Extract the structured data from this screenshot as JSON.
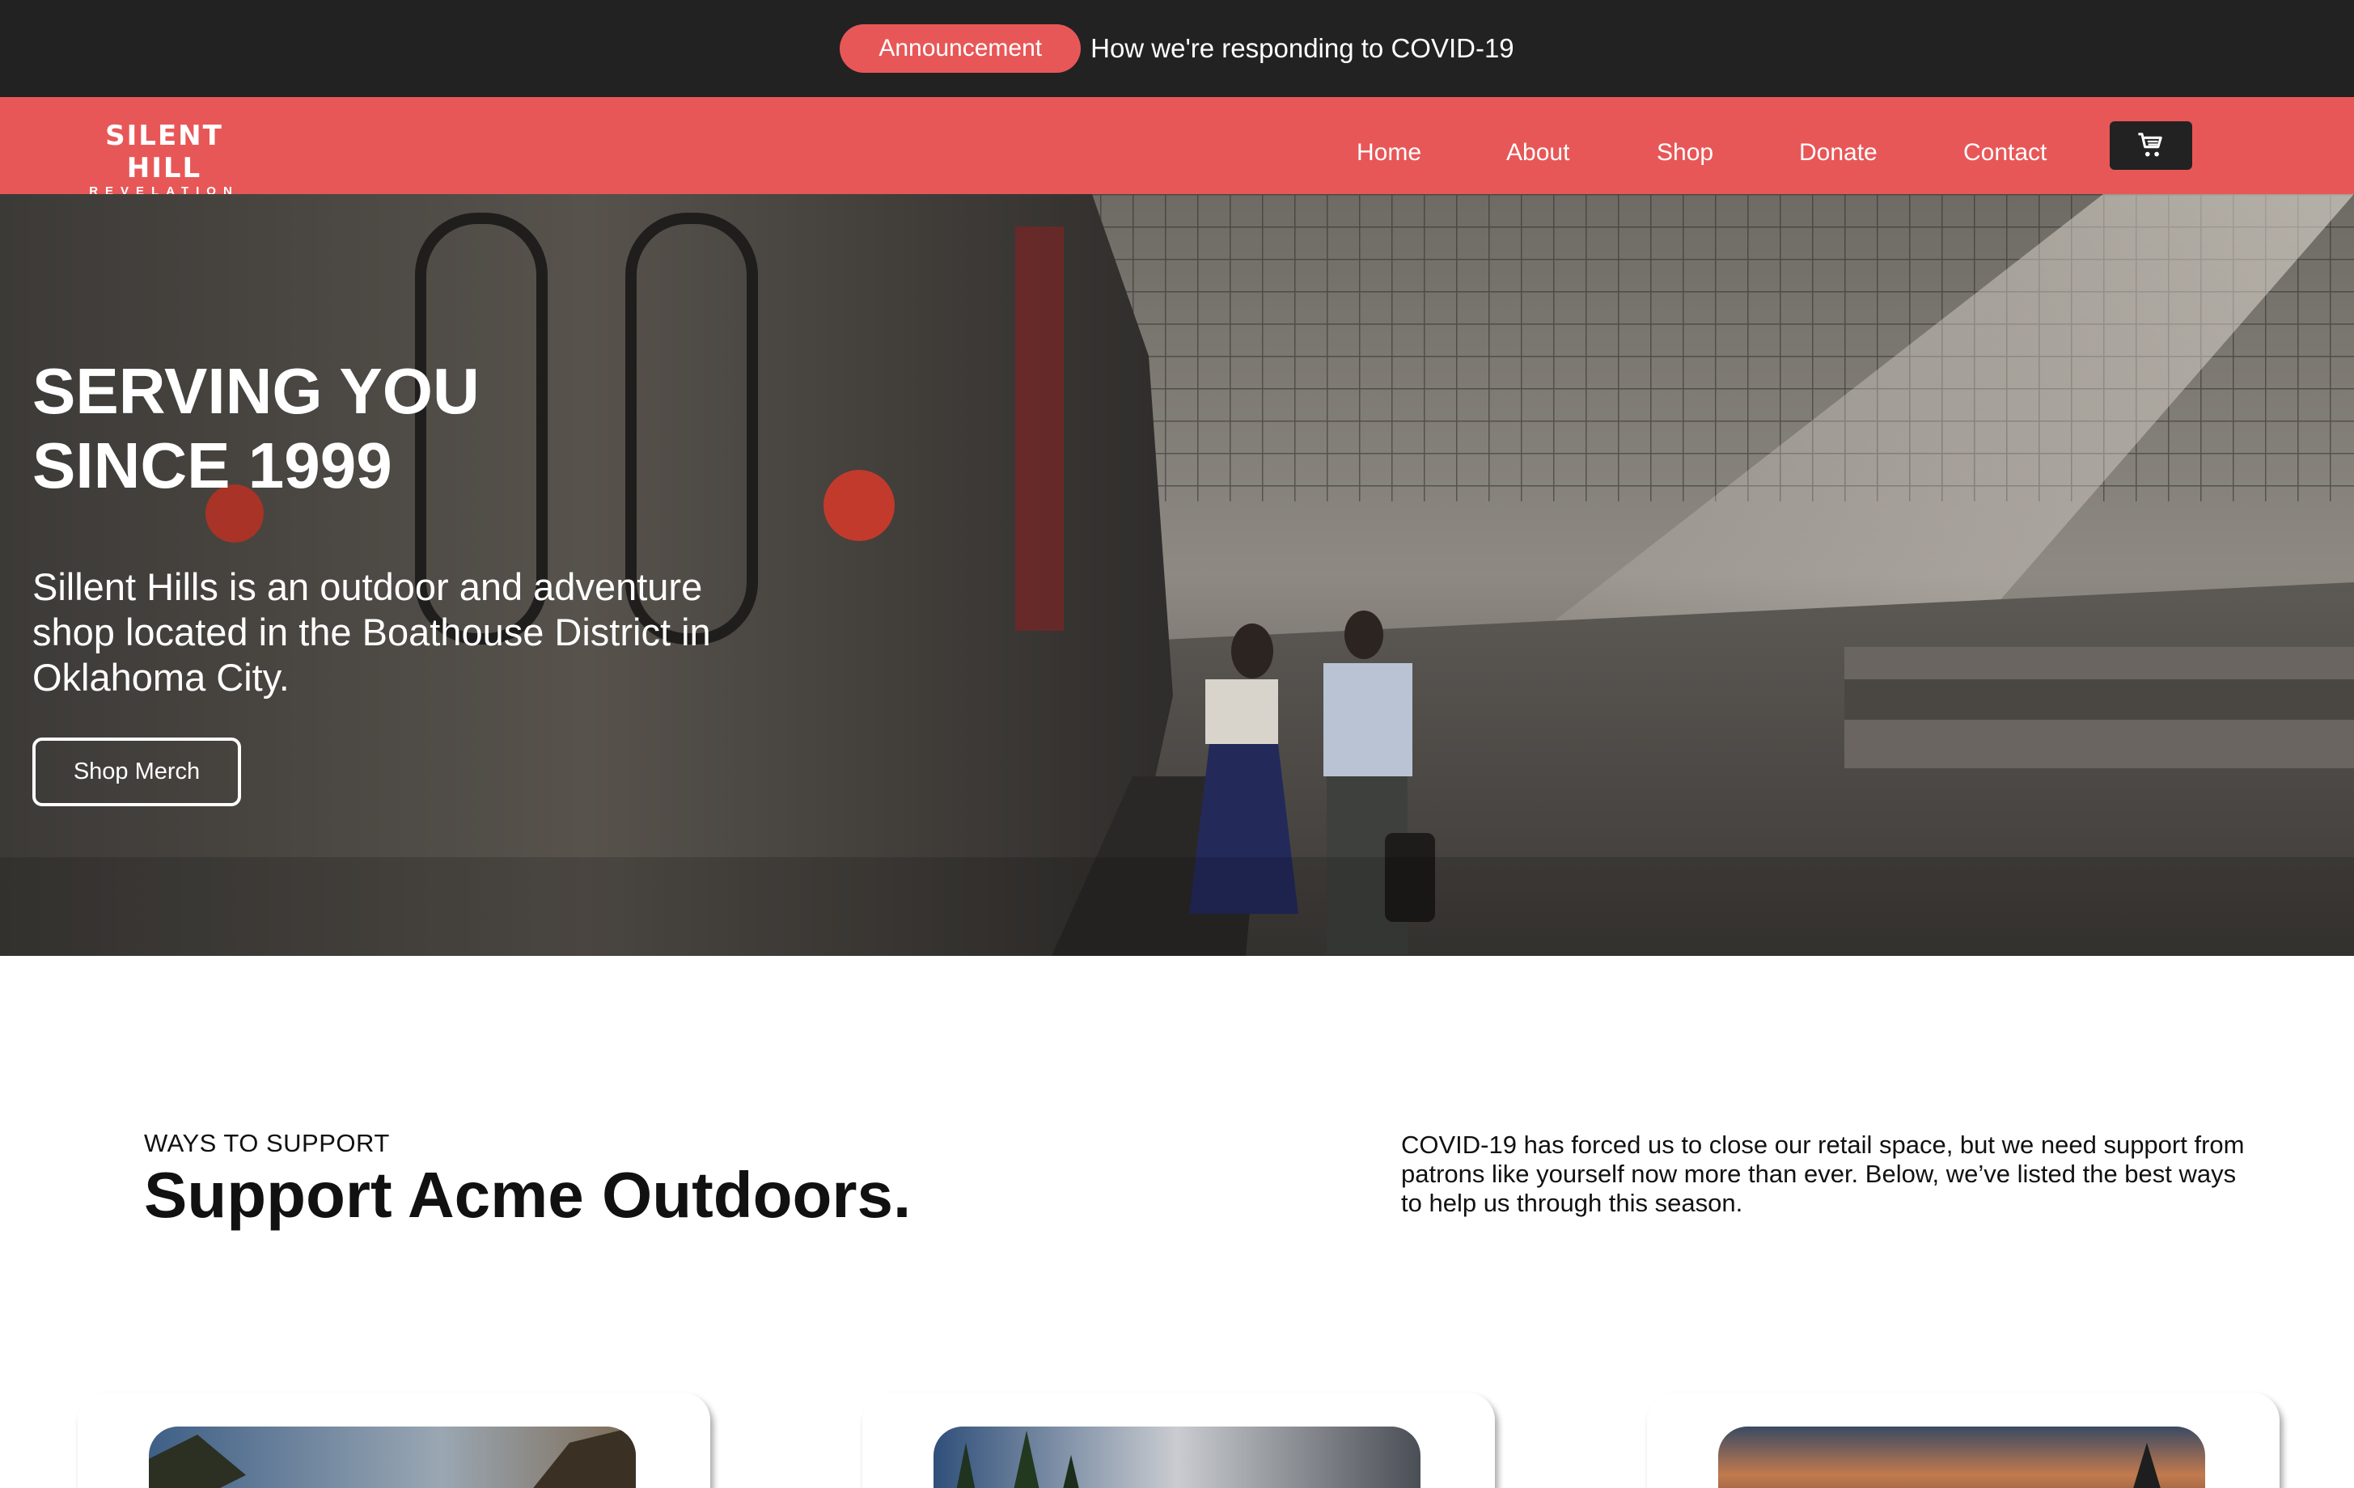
{
  "announcement": {
    "badge": "Announcement",
    "link": "How we're responding to COVID-19"
  },
  "nav": {
    "logo": {
      "main": "SILENT HILL",
      "sub": "REVELATION"
    },
    "items": [
      "Home",
      "About",
      "Shop",
      "Donate",
      "Contact"
    ],
    "cart_icon": "shopping-cart-icon"
  },
  "hero": {
    "title_line1": "SERVING YOU",
    "title_line2": "SINCE 1999",
    "description": "Sillent Hills is an outdoor and adventure shop located in the Boathouse District in Oklahoma City.",
    "cta": "Shop Merch"
  },
  "support": {
    "eyebrow": "WAYS TO SUPPORT",
    "title": "Support Acme Outdoors.",
    "description": "COVID-19 has forced us to close our retail space, but we need support from patrons like yourself now more than ever. Below, we’ve listed the best ways to help us through this season."
  },
  "colors": {
    "brand": "#e85757",
    "dark": "#222222",
    "white": "#ffffff"
  }
}
